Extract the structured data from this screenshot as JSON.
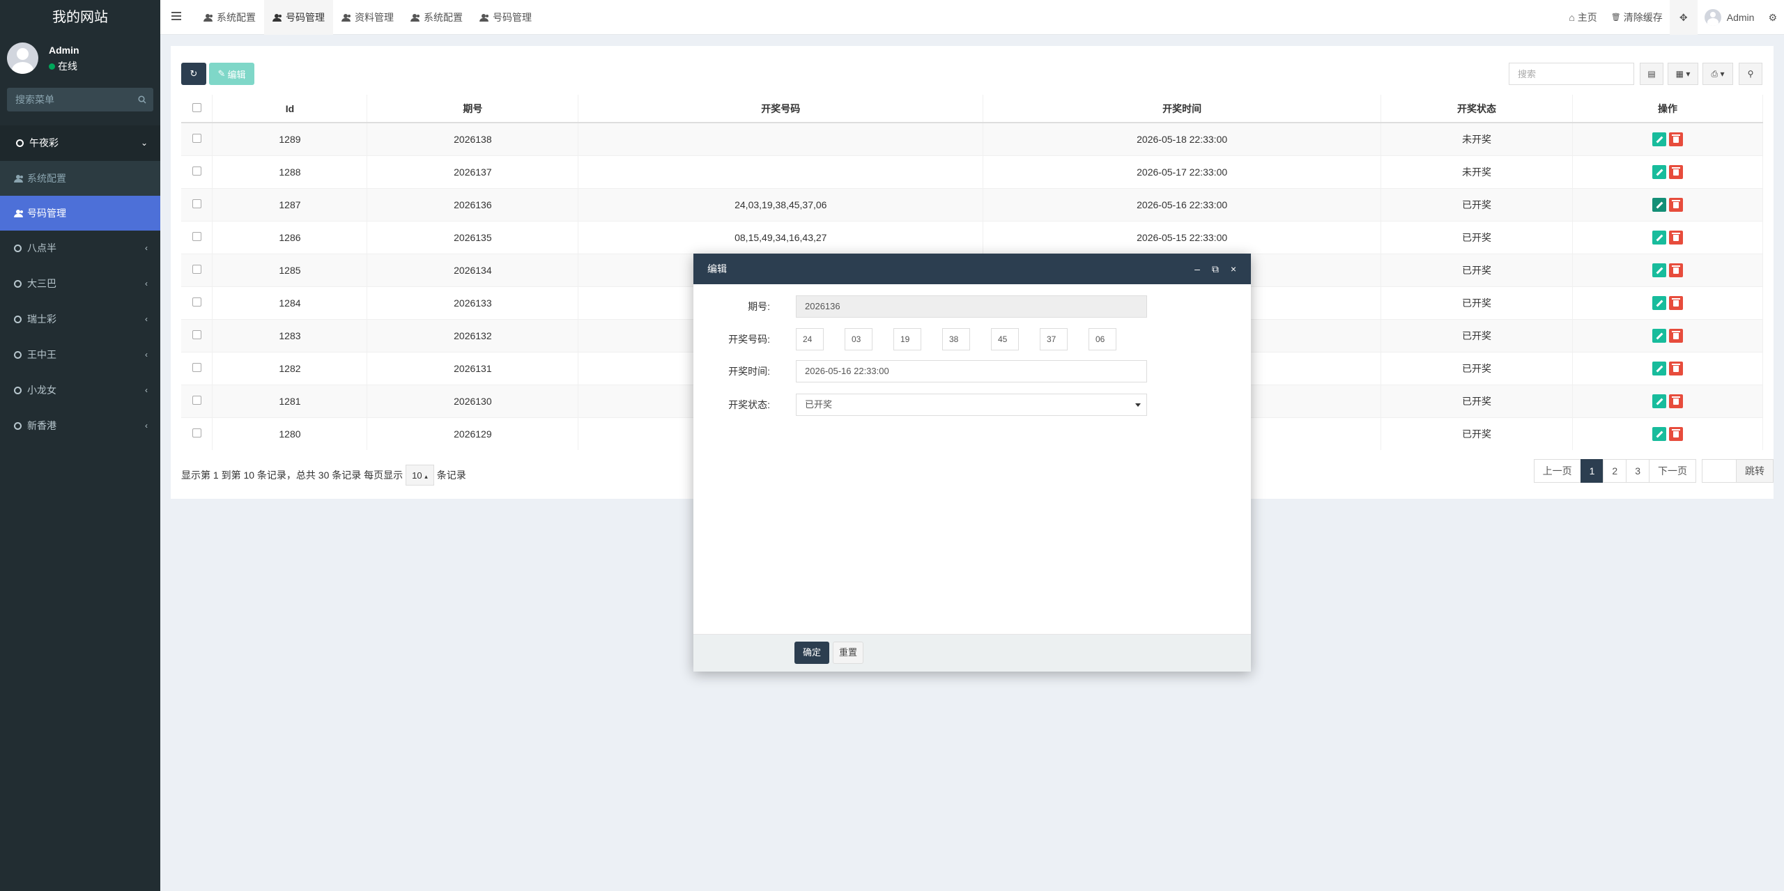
{
  "site_title": "我的网站",
  "user": {
    "name": "Admin",
    "status": "在线"
  },
  "sidebar": {
    "search_placeholder": "搜索菜单",
    "groups": [
      {
        "label": "午夜彩",
        "children": [
          {
            "label": "系统配置"
          },
          {
            "label": "号码管理"
          }
        ]
      },
      {
        "label": "八点半"
      },
      {
        "label": "大三巴"
      },
      {
        "label": "瑞士彩"
      },
      {
        "label": "王中王"
      },
      {
        "label": "小龙女"
      },
      {
        "label": "新香港"
      }
    ]
  },
  "header": {
    "tabs": [
      {
        "label": "系统配置"
      },
      {
        "label": "号码管理"
      },
      {
        "label": "资料管理"
      },
      {
        "label": "系统配置"
      },
      {
        "label": "号码管理"
      }
    ],
    "home": "主页",
    "clear_cache": "清除缓存",
    "admin": "Admin"
  },
  "toolbar": {
    "edit_label": "编辑",
    "search_placeholder": "搜索"
  },
  "table": {
    "columns": [
      "Id",
      "期号",
      "开奖号码",
      "开奖时间",
      "开奖状态",
      "操作"
    ],
    "rows": [
      {
        "id": "1289",
        "period": "2026138",
        "numbers": "",
        "time": "2026-05-18 22:33:00",
        "status": "未开奖"
      },
      {
        "id": "1288",
        "period": "2026137",
        "numbers": "",
        "time": "2026-05-17 22:33:00",
        "status": "未开奖"
      },
      {
        "id": "1287",
        "period": "2026136",
        "numbers": "24,03,19,38,45,37,06",
        "time": "2026-05-16 22:33:00",
        "status": "已开奖"
      },
      {
        "id": "1286",
        "period": "2026135",
        "numbers": "08,15,49,34,16,43,27",
        "time": "2026-05-15 22:33:00",
        "status": "已开奖"
      },
      {
        "id": "1285",
        "period": "2026134",
        "numbers": "",
        "time": "",
        "status": "已开奖"
      },
      {
        "id": "1284",
        "period": "2026133",
        "numbers": "",
        "time": "",
        "status": "已开奖"
      },
      {
        "id": "1283",
        "period": "2026132",
        "numbers": "",
        "time": "",
        "status": "已开奖"
      },
      {
        "id": "1282",
        "period": "2026131",
        "numbers": "",
        "time": "",
        "status": "已开奖"
      },
      {
        "id": "1281",
        "period": "2026130",
        "numbers": "",
        "time": "",
        "status": "已开奖"
      },
      {
        "id": "1280",
        "period": "2026129",
        "numbers": "",
        "time": "",
        "status": "已开奖"
      }
    ]
  },
  "pager": {
    "info_prefix": "显示第 1 到第 10 条记录，总共 30 条记录 每页显示",
    "page_size": "10",
    "info_suffix": "条记录",
    "prev": "上一页",
    "pages": [
      "1",
      "2",
      "3"
    ],
    "next": "下一页",
    "jump": "跳转"
  },
  "modal": {
    "title": "编辑",
    "period_label": "期号:",
    "period_value": "2026136",
    "numbers_label": "开奖号码:",
    "numbers": [
      "24",
      "03",
      "19",
      "38",
      "45",
      "37",
      "06"
    ],
    "time_label": "开奖时间:",
    "time_value": "2026-05-16 22:33:00",
    "status_label": "开奖状态:",
    "status_value": "已开奖",
    "ok": "确定",
    "reset": "重置"
  },
  "colors": {
    "sidebar_bg": "#222d32",
    "accent": "#4d70d8",
    "dark": "#2c3e50",
    "success": "#18bc9c",
    "danger": "#e74c3c"
  }
}
